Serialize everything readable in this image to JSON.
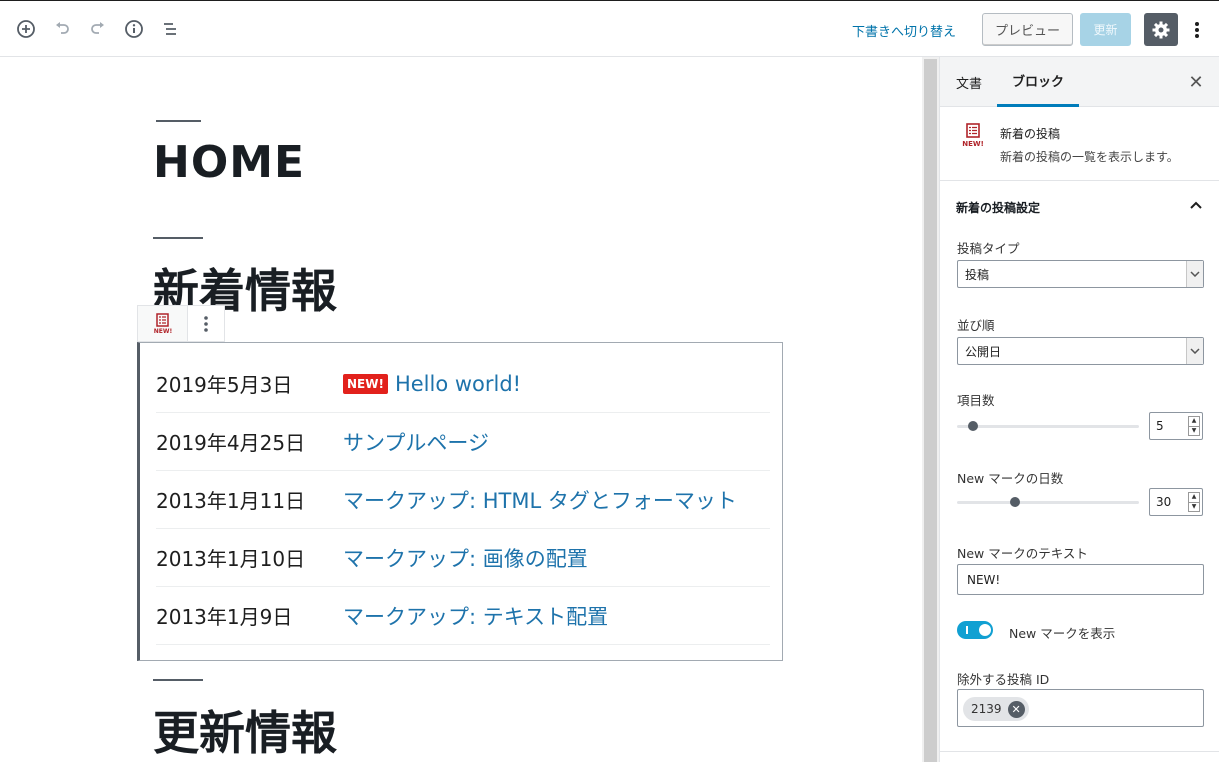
{
  "toolbar": {
    "add_icon": "plus-circle-icon",
    "undo_icon": "undo-icon",
    "redo_icon": "redo-icon",
    "info_icon": "info-icon",
    "outline_icon": "list-outline-icon",
    "draft_link": "下書きへ切り替え",
    "preview_label": "プレビュー",
    "update_label": "更新",
    "settings_icon": "gear-icon",
    "more_icon": "vertical-ellipsis-icon"
  },
  "editor": {
    "headings": {
      "home": "HOME",
      "latest": "新着情報",
      "updates": "更新情報"
    },
    "block_toolbar": {
      "icon": "new-posts-icon",
      "icon_text": "NEW!",
      "more_icon": "vertical-ellipsis-icon"
    },
    "posts": [
      {
        "date": "2019年5月3日",
        "badge": "NEW!",
        "title": "Hello world!"
      },
      {
        "date": "2019年4月25日",
        "badge": "",
        "title": "サンプルページ"
      },
      {
        "date": "2013年1月11日",
        "badge": "",
        "title": "マークアップ: HTML タグとフォーマット"
      },
      {
        "date": "2013年1月10日",
        "badge": "",
        "title": "マークアップ: 画像の配置"
      },
      {
        "date": "2013年1月9日",
        "badge": "",
        "title": "マークアップ: テキスト配置"
      }
    ]
  },
  "sidebar": {
    "tabs": [
      {
        "label": "文書",
        "active": false
      },
      {
        "label": "ブロック",
        "active": true
      }
    ],
    "close_icon": "close-icon",
    "block_card": {
      "icon": "new-posts-icon",
      "icon_text": "NEW!",
      "title": "新着の投稿",
      "description": "新着の投稿の一覧を表示します。"
    },
    "panel": {
      "title": "新着の投稿設定",
      "expanded": true,
      "post_type": {
        "label": "投稿タイプ",
        "value": "投稿"
      },
      "order": {
        "label": "並び順",
        "value": "公開日"
      },
      "count": {
        "label": "項目数",
        "value": "5",
        "slider_fraction": 0.09
      },
      "new_days": {
        "label": "New マークの日数",
        "value": "30",
        "slider_fraction": 0.32
      },
      "new_text": {
        "label": "New マークのテキスト",
        "value": "NEW!"
      },
      "show_new": {
        "label": "New マークを表示",
        "checked": true
      },
      "exclude_ids": {
        "label": "除外する投稿 ID",
        "tokens": [
          "2139"
        ]
      }
    }
  },
  "colors": {
    "accent": "#0073aa",
    "badge": "#e2211c",
    "toggle": "#11a0d2",
    "settings_bg": "#555d66",
    "link": "#1e73ab"
  }
}
